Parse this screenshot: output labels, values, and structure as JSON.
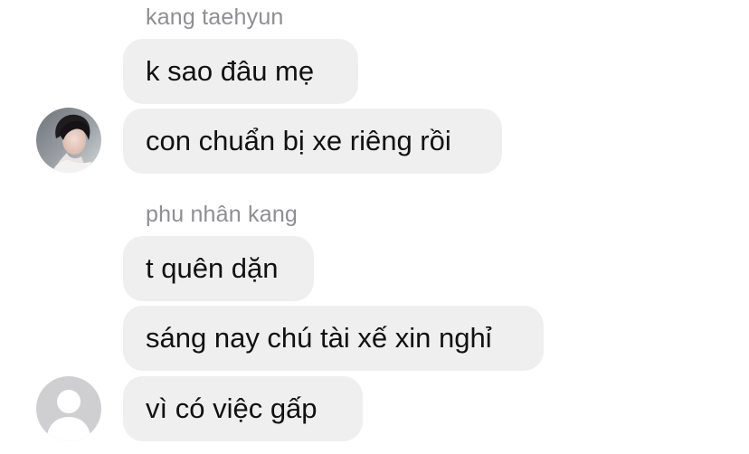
{
  "groups": [
    {
      "sender": "kang taehyun",
      "avatar_icon": "user-photo-avatar",
      "messages": [
        "k sao đâu mẹ",
        "con chuẩn bị xe riêng rồi"
      ]
    },
    {
      "sender": "phu nhân kang",
      "avatar_icon": "default-user-avatar-icon",
      "messages": [
        "t quên dặn",
        "sáng nay chú tài xế xin nghỉ",
        "vì có việc gấp"
      ]
    }
  ],
  "colors": {
    "bubble_background": "#efeff0",
    "sender_name": "#8e8e93",
    "message_text": "#111111",
    "default_avatar_bg": "#cfcfd2"
  }
}
